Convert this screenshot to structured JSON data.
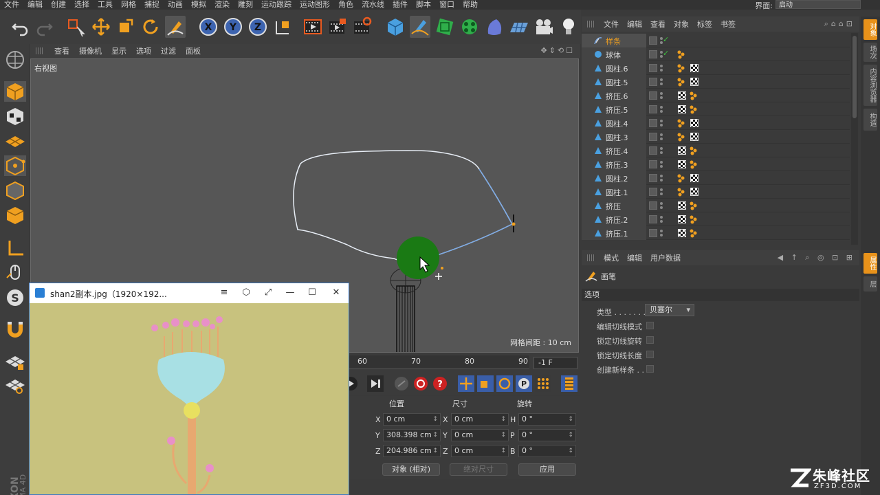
{
  "menubar": {
    "items": [
      "文件",
      "编辑",
      "创建",
      "选择",
      "工具",
      "网格",
      "捕捉",
      "动画",
      "模拟",
      "渲染",
      "雕刻",
      "运动跟踪",
      "运动图形",
      "角色",
      "流水线",
      "插件",
      "脚本",
      "窗口",
      "帮助"
    ],
    "ui_label": "界面:",
    "ui_value": "启动"
  },
  "viewport": {
    "menu": [
      "查看",
      "摄像机",
      "显示",
      "选项",
      "过滤",
      "面板"
    ],
    "label": "右视图",
    "grid_spacing": "网格间距 : 10 cm"
  },
  "timeline": {
    "ticks": [
      "60",
      "70",
      "80",
      "90"
    ],
    "frame": "-1 F"
  },
  "coords": {
    "headers": {
      "pos": "位置",
      "size": "尺寸",
      "rot": "旋转"
    },
    "rows": [
      {
        "axis": "X",
        "pos": "0 cm",
        "size_axis": "X",
        "size": "0 cm",
        "rot_axis": "H",
        "rot": "0 °"
      },
      {
        "axis": "Y",
        "pos": "308.398 cm",
        "size_axis": "Y",
        "size": "0 cm",
        "rot_axis": "P",
        "rot": "0 °"
      },
      {
        "axis": "Z",
        "pos": "204.986 cm",
        "size_axis": "Z",
        "size": "0 cm",
        "rot_axis": "B",
        "rot": "0 °"
      }
    ],
    "mode_select": "对象 (相对)",
    "size_select": "绝对尺寸",
    "apply": "应用"
  },
  "object_manager": {
    "menu": [
      "文件",
      "编辑",
      "查看",
      "对象",
      "标签",
      "书签"
    ],
    "objects": [
      {
        "name": "样条",
        "highlight": true,
        "check": true,
        "tags": []
      },
      {
        "name": "球体",
        "highlight": false,
        "check": true,
        "tags": [
          "phong"
        ]
      },
      {
        "name": "圆柱.6",
        "highlight": false,
        "check": false,
        "tags": [
          "phong",
          "check"
        ]
      },
      {
        "name": "圆柱.5",
        "highlight": false,
        "check": false,
        "tags": [
          "phong",
          "check"
        ]
      },
      {
        "name": "挤压.6",
        "highlight": false,
        "check": false,
        "tags": [
          "check",
          "phong"
        ]
      },
      {
        "name": "挤压.5",
        "highlight": false,
        "check": false,
        "tags": [
          "check",
          "phong"
        ]
      },
      {
        "name": "圆柱.4",
        "highlight": false,
        "check": false,
        "tags": [
          "phong",
          "check"
        ]
      },
      {
        "name": "圆柱.3",
        "highlight": false,
        "check": false,
        "tags": [
          "phong",
          "check"
        ]
      },
      {
        "name": "挤压.4",
        "highlight": false,
        "check": false,
        "tags": [
          "check",
          "phong"
        ]
      },
      {
        "name": "挤压.3",
        "highlight": false,
        "check": false,
        "tags": [
          "check",
          "phong"
        ]
      },
      {
        "name": "圆柱.2",
        "highlight": false,
        "check": false,
        "tags": [
          "phong",
          "check"
        ]
      },
      {
        "name": "圆柱.1",
        "highlight": false,
        "check": false,
        "tags": [
          "phong",
          "check"
        ]
      },
      {
        "name": "挤压",
        "highlight": false,
        "check": false,
        "tags": [
          "check",
          "phong"
        ]
      },
      {
        "name": "挤压.2",
        "highlight": false,
        "check": false,
        "tags": [
          "check",
          "phong"
        ]
      },
      {
        "name": "挤压.1",
        "highlight": false,
        "check": false,
        "tags": [
          "check",
          "phong"
        ]
      }
    ]
  },
  "attributes": {
    "menu": [
      "模式",
      "编辑",
      "用户数据"
    ],
    "tool_title": "画笔",
    "section": "选项",
    "type_label": "类型 . . . . . . . .",
    "type_value": "贝塞尔",
    "options": [
      "编辑切线模式",
      "锁定切线旋转",
      "锁定切线长度",
      "创建新样条 . ."
    ]
  },
  "right_tabs": [
    "对象",
    "场次",
    "内容浏览器",
    "构造",
    "属性",
    "层"
  ],
  "image_window": {
    "title": "shan2副本.jpg（1920×192...",
    "controls": [
      "≡",
      "⬡",
      "⤢",
      "—",
      "☐",
      "✕"
    ]
  },
  "watermark": {
    "cn": "朱峰社区",
    "en": "ZF3D.COM"
  },
  "colors": {
    "accent": "#e8921a",
    "sphere": "#1a7a14",
    "spline": "#8fb5e8",
    "window_border": "#3a78c4"
  }
}
